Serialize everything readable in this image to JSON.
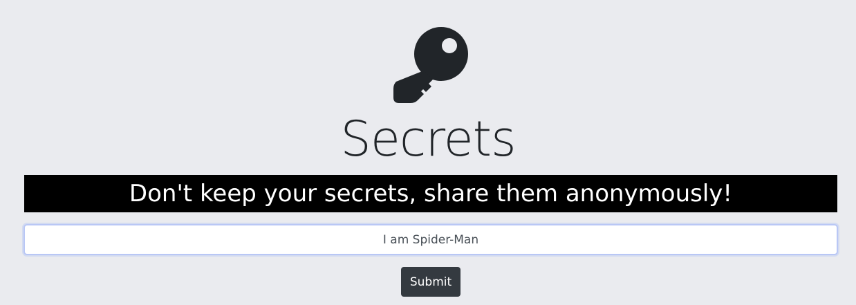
{
  "header": {
    "icon": "key-icon",
    "title": "Secrets"
  },
  "banner": {
    "text": "Don't keep your secrets, share them anonymously!"
  },
  "form": {
    "secret_value": "I am Spider-Man",
    "submit_label": "Submit"
  },
  "colors": {
    "background": "#eaebef",
    "banner_background": "#000000",
    "banner_text": "#ffffff",
    "button_background": "#343a40",
    "input_focus_border": "#b9c7f5",
    "icon": "#212529"
  }
}
